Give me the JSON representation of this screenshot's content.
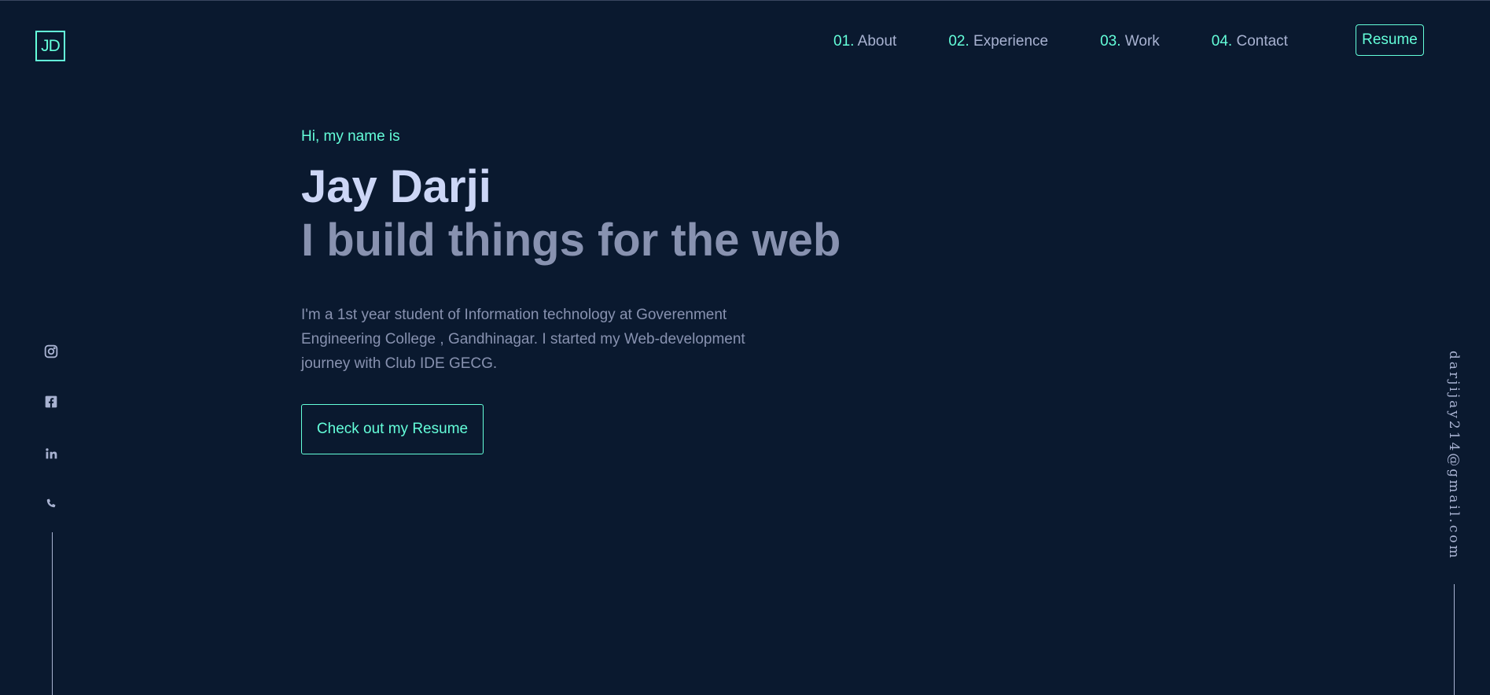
{
  "logo": {
    "text": "JD"
  },
  "nav": {
    "items": [
      {
        "num": "01.",
        "label": "About"
      },
      {
        "num": "02.",
        "label": "Experience"
      },
      {
        "num": "03.",
        "label": "Work"
      },
      {
        "num": "04.",
        "label": "Contact"
      }
    ],
    "resume_label": "Resume"
  },
  "hero": {
    "greeting": "Hi, my name is",
    "name": "Jay Darji",
    "tagline": "I build things for the web",
    "bio": "I'm a 1st year student of Information technology at Goverenment Engineering College , Gandhinagar. I started my Web-development journey with Club IDE GECG.",
    "cta_label": "Check out my Resume"
  },
  "socials": [
    {
      "icon": "instagram-icon"
    },
    {
      "icon": "facebook-icon"
    },
    {
      "icon": "linkedin-icon"
    },
    {
      "icon": "phone-icon"
    }
  ],
  "email": "darjijay214@gmail.com",
  "colors": {
    "background": "#0a192f",
    "accent": "#64ffda",
    "heading": "#ccd6f6",
    "muted": "#8892b0",
    "nav_text": "#a8b2d1"
  }
}
